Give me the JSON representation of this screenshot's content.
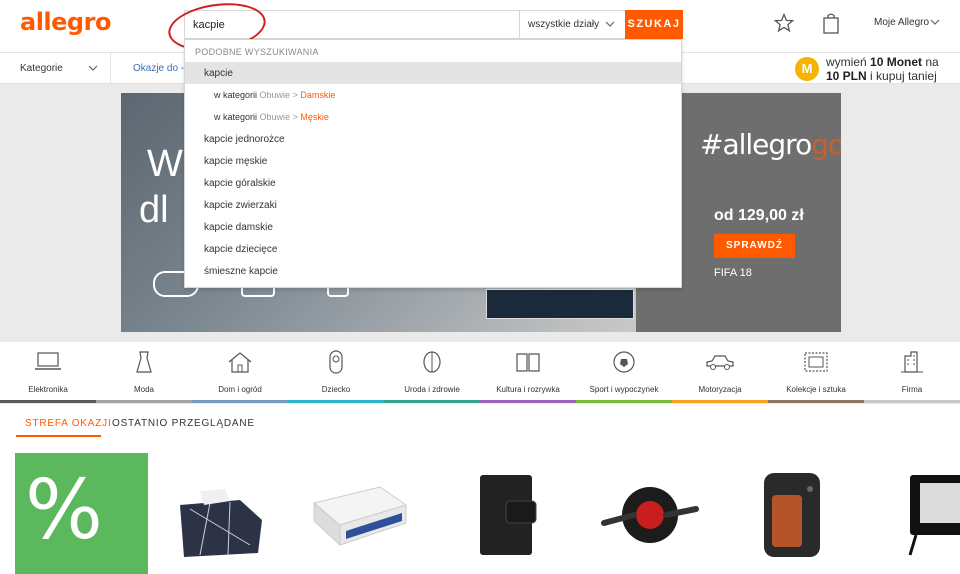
{
  "header": {
    "logo": "allegro",
    "search_value": "kacpie",
    "department": "wszystkie działy",
    "search_button": "SZUKAJ",
    "account": "Moje Allegro"
  },
  "nav": {
    "categories": "Kategorie",
    "deals": "Okazje do -70",
    "promo_line1_pre": "wymień ",
    "promo_line1_bold": "10 Monet",
    "promo_line1_post": " na",
    "promo_line2_bold": "10 PLN",
    "promo_line2_post": " i kupuj taniej",
    "coin_letter": "M"
  },
  "suggestions": {
    "heading": "PODOBNE WYSZUKIWANIA",
    "items": [
      {
        "text": "kapcie",
        "active": true
      },
      {
        "prefix": "w kategorii",
        "path": "Obuwie >",
        "target": "Damskie"
      },
      {
        "prefix": "w kategorii",
        "path": "Obuwie >",
        "target": "Męskie"
      },
      {
        "text": "kapcie jednorożce"
      },
      {
        "text": "kapcie męskie"
      },
      {
        "text": "kapcie góralskie"
      },
      {
        "text": "kapcie zwierzaki"
      },
      {
        "text": "kapcie damskie"
      },
      {
        "text": "kapcie dziecięce"
      },
      {
        "text": "śmieszne kapcie"
      }
    ]
  },
  "banner": {
    "letter_w": "W",
    "letters_dl": "dl",
    "hashtag_main": "#allegro",
    "hashtag_tail": "go",
    "price": "od 129,00 zł",
    "cta": "SPRAWDŹ",
    "product": "FIFA 18"
  },
  "categories": [
    {
      "label": "Elektronika",
      "icon": "laptop-icon",
      "color": "#5a5a5a"
    },
    {
      "label": "Moda",
      "icon": "dress-icon",
      "color": "#a3a3a3"
    },
    {
      "label": "Dom i ogród",
      "icon": "house-icon",
      "color": "#7a9bc0"
    },
    {
      "label": "Dziecko",
      "icon": "baby-icon",
      "color": "#2fb5c8"
    },
    {
      "label": "Uroda i zdrowie",
      "icon": "face-icon",
      "color": "#31a38f"
    },
    {
      "label": "Kultura i rozrywka",
      "icon": "book-icon",
      "color": "#9d63b8"
    },
    {
      "label": "Sport i wypoczynek",
      "icon": "ball-icon",
      "color": "#7bb83a"
    },
    {
      "label": "Motoryzacja",
      "icon": "car-icon",
      "color": "#f4a21e"
    },
    {
      "label": "Kolekcje i sztuka",
      "icon": "stamp-icon",
      "color": "#8a7660"
    },
    {
      "label": "Firma",
      "icon": "building-icon",
      "color": "#c8c8c8"
    }
  ],
  "tabs": {
    "deals": "STREFA OKAZJI",
    "recent": "OSTATNIO PRZEGLĄDANE"
  },
  "promo_symbol": "%"
}
